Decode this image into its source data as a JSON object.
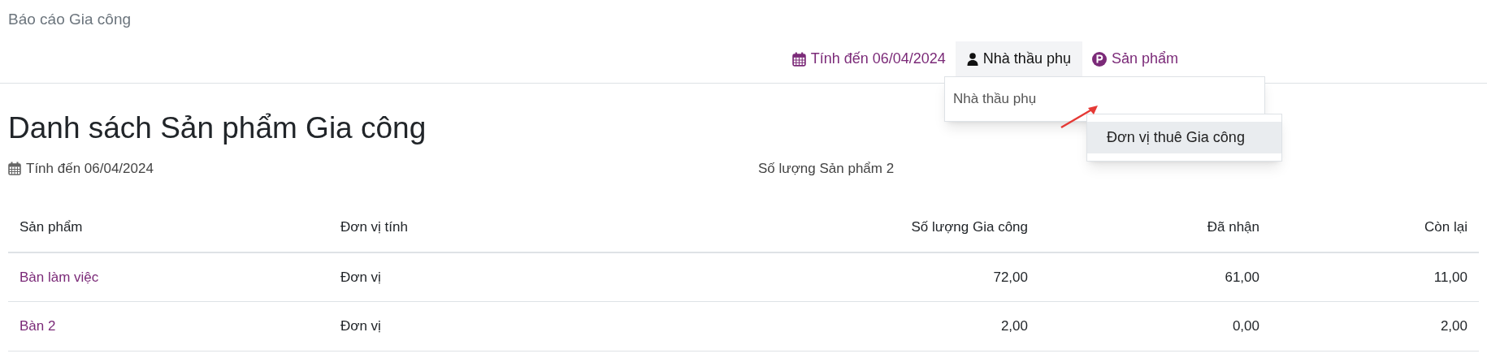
{
  "breadcrumb": "Báo cáo Gia công",
  "filters": [
    {
      "kind": "date",
      "label": "Tính đến 06/04/2024",
      "selected": false
    },
    {
      "kind": "person",
      "label": "Nhà thầu phụ",
      "selected": true
    },
    {
      "kind": "product",
      "label": "Sản phẩm",
      "selected": false
    }
  ],
  "filter_input": {
    "value": "Nhà thầu phụ"
  },
  "suggestions": [
    {
      "label": "Đơn vị thuê Gia công",
      "selected": true
    }
  ],
  "heading": "Danh sách Sản phẩm Gia công",
  "as_of": "Tính đến 06/04/2024",
  "product_count": "Số lượng Sản phẩm 2",
  "table": {
    "columns": [
      "Sản phẩm",
      "Đơn vị tính",
      "Số lượng Gia công",
      "Đã nhận",
      "Còn lại"
    ],
    "rows": [
      [
        "Bàn làm việc",
        "Đơn vị",
        "72,00",
        "61,00",
        "11,00"
      ],
      [
        "Bàn 2",
        "Đơn vị",
        "2,00",
        "0,00",
        "2,00"
      ]
    ]
  }
}
